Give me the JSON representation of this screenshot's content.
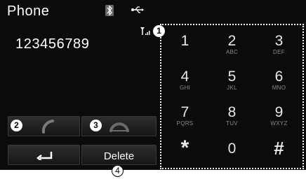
{
  "header": {
    "title": "Phone",
    "icons": [
      "bluetooth-icon",
      "usb-icon"
    ]
  },
  "status": {
    "signal_icon": "signal-strength-icon"
  },
  "dialed_number": "123456789",
  "buttons": {
    "call_icon": "handset-call-icon",
    "end_icon": "handset-end-icon",
    "back_icon": "back-arrow-icon",
    "delete_label": "Delete"
  },
  "keypad": {
    "keys": [
      {
        "digit": "1",
        "letters": ""
      },
      {
        "digit": "2",
        "letters": "ABC"
      },
      {
        "digit": "3",
        "letters": "DEF"
      },
      {
        "digit": "4",
        "letters": "GHI"
      },
      {
        "digit": "5",
        "letters": "JKL"
      },
      {
        "digit": "6",
        "letters": "MNO"
      },
      {
        "digit": "7",
        "letters": "PQRS"
      },
      {
        "digit": "8",
        "letters": "TUV"
      },
      {
        "digit": "9",
        "letters": "WXYZ"
      },
      {
        "digit": "*",
        "letters": ""
      },
      {
        "digit": "0",
        "letters": ""
      },
      {
        "digit": "#",
        "letters": ""
      }
    ]
  },
  "callouts": [
    "1",
    "2",
    "3",
    "4"
  ],
  "colors": {
    "screen_bg": "#0b0b0b",
    "call_green": "#6f6f6f",
    "text": "#ffffff"
  }
}
